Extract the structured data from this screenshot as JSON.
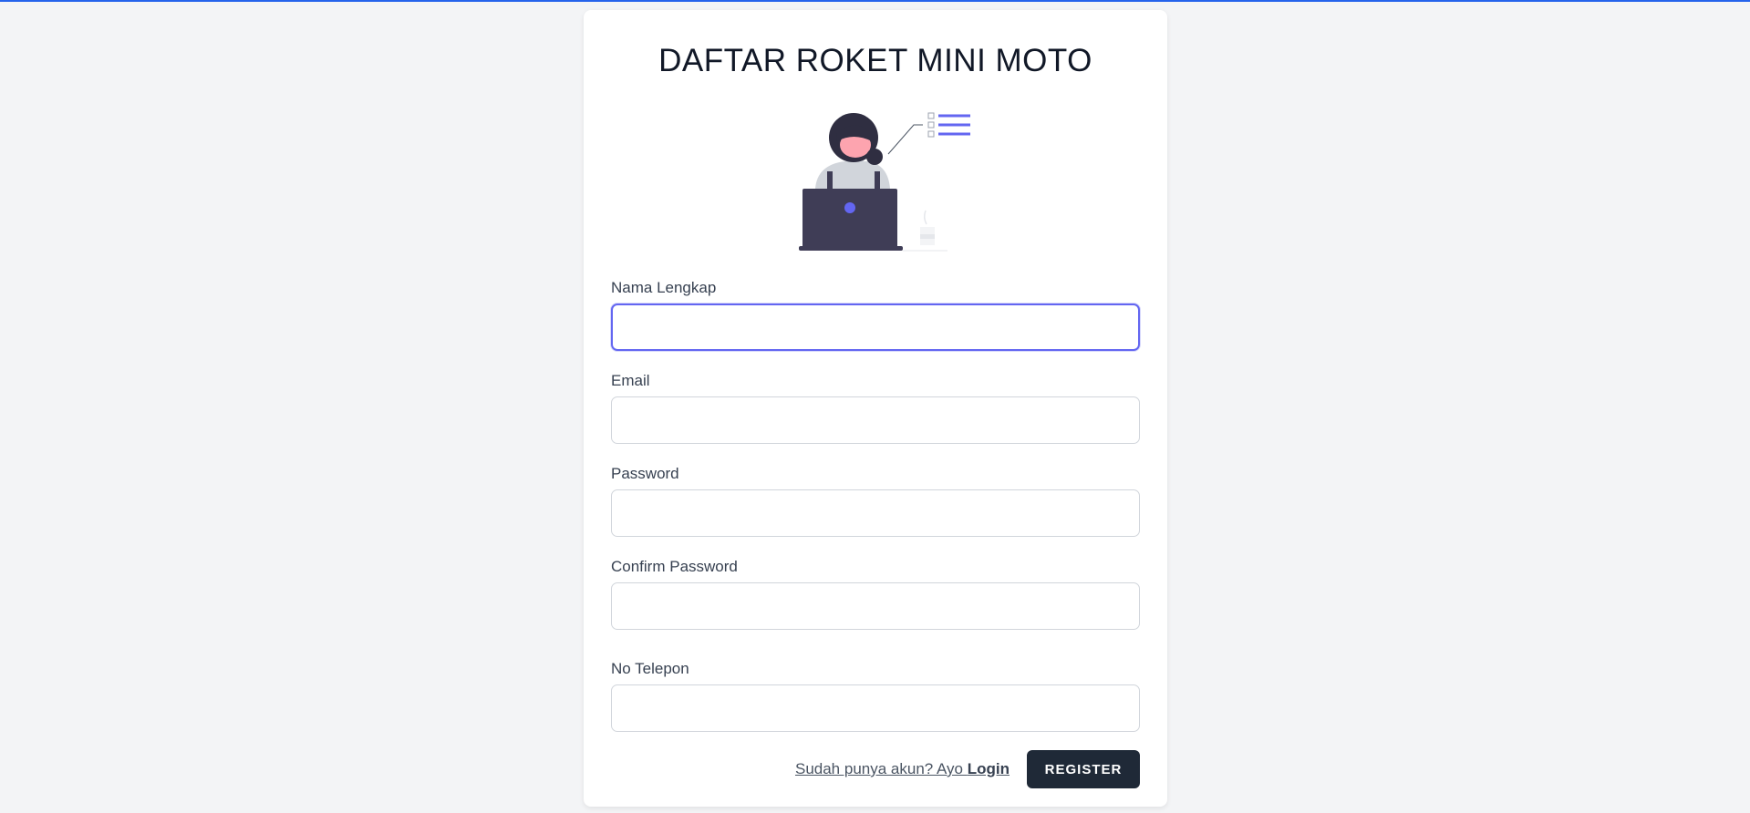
{
  "form": {
    "title": "DAFTAR ROKET MINI MOTO",
    "fields": [
      {
        "label": "Nama Lengkap",
        "value": "",
        "placeholder": ""
      },
      {
        "label": "Email",
        "value": "",
        "placeholder": ""
      },
      {
        "label": "Password",
        "value": "",
        "placeholder": ""
      },
      {
        "label": "Confirm Password",
        "value": "",
        "placeholder": ""
      },
      {
        "label": "No Telepon",
        "value": "",
        "placeholder": ""
      }
    ],
    "login_prompt": "Sudah punya akun? Ayo",
    "login_label": "Login",
    "register_label": "REGISTER"
  },
  "colors": {
    "background": "#f3f4f6",
    "accent": "#6366f1",
    "button": "#1f2937",
    "top_bar": "#2563eb"
  },
  "illustration": {
    "icon": "woman-at-laptop-checklist-illustration"
  }
}
